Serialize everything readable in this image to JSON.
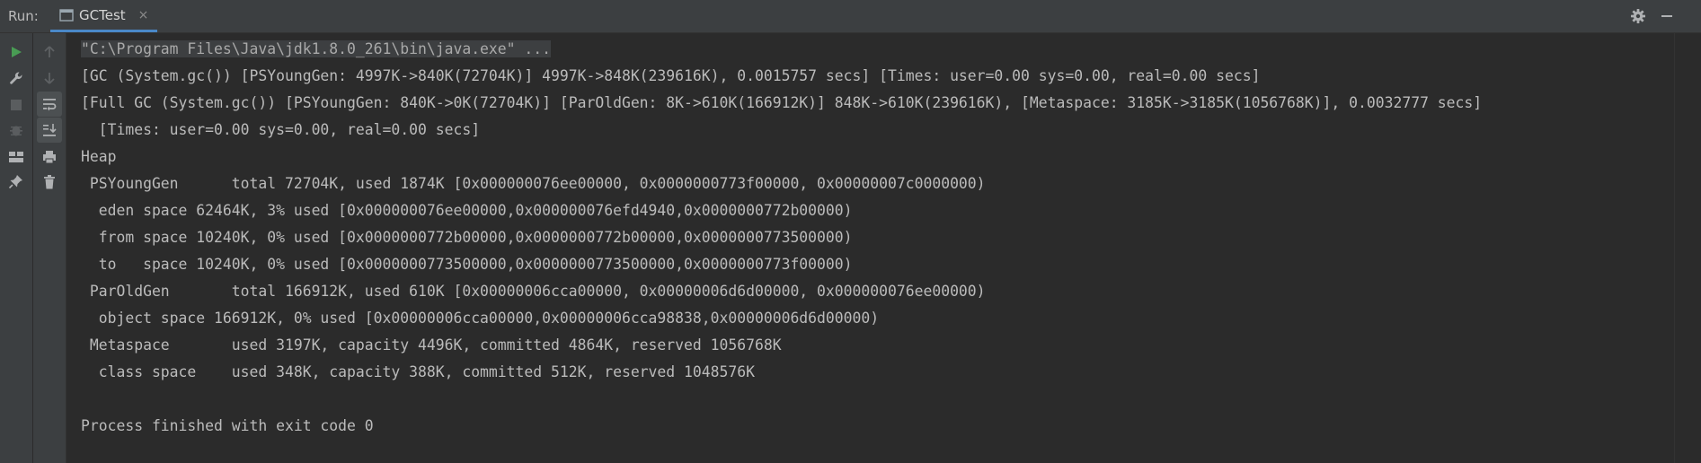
{
  "run_panel": {
    "label": "Run:",
    "tab": {
      "title": "GCTest",
      "close_glyph": "×"
    },
    "header_icons": [
      "gear-icon",
      "minimize-icon"
    ]
  },
  "toolbar": {
    "outer": [
      "run-icon",
      "wrench-icon",
      "stop-icon",
      "debug-bug-icon",
      "layout-icon",
      "pin-icon"
    ],
    "inner": [
      "arrow-up-icon",
      "arrow-down-icon",
      "soft-wrap-icon",
      "scroll-to-end-icon",
      "print-icon",
      "trash-icon"
    ]
  },
  "console": {
    "lines": [
      "\"C:\\Program Files\\Java\\jdk1.8.0_261\\bin\\java.exe\" ...",
      "[GC (System.gc()) [PSYoungGen: 4997K->840K(72704K)] 4997K->848K(239616K), 0.0015757 secs] [Times: user=0.00 sys=0.00, real=0.00 secs]",
      "[Full GC (System.gc()) [PSYoungGen: 840K->0K(72704K)] [ParOldGen: 8K->610K(166912K)] 848K->610K(239616K), [Metaspace: 3185K->3185K(1056768K)], 0.0032777 secs]",
      "  [Times: user=0.00 sys=0.00, real=0.00 secs]",
      "Heap",
      " PSYoungGen      total 72704K, used 1874K [0x000000076ee00000, 0x0000000773f00000, 0x00000007c0000000)",
      "  eden space 62464K, 3% used [0x000000076ee00000,0x000000076efd4940,0x0000000772b00000)",
      "  from space 10240K, 0% used [0x0000000772b00000,0x0000000772b00000,0x0000000773500000)",
      "  to   space 10240K, 0% used [0x0000000773500000,0x0000000773500000,0x0000000773f00000)",
      " ParOldGen       total 166912K, used 610K [0x00000006cca00000, 0x00000006d6d00000, 0x000000076ee00000)",
      "  object space 166912K, 0% used [0x00000006cca00000,0x00000006cca98838,0x00000006d6d00000)",
      " Metaspace       used 3197K, capacity 4496K, committed 4864K, reserved 1056768K",
      "  class space    used 348K, capacity 388K, committed 512K, reserved 1048576K",
      "",
      "Process finished with exit code 0"
    ]
  },
  "colors": {
    "background": "#2b2b2b",
    "panel": "#3c3f41",
    "text": "#bbbbbb",
    "run_green": "#499c54",
    "tab_underline": "#4a88c7"
  }
}
